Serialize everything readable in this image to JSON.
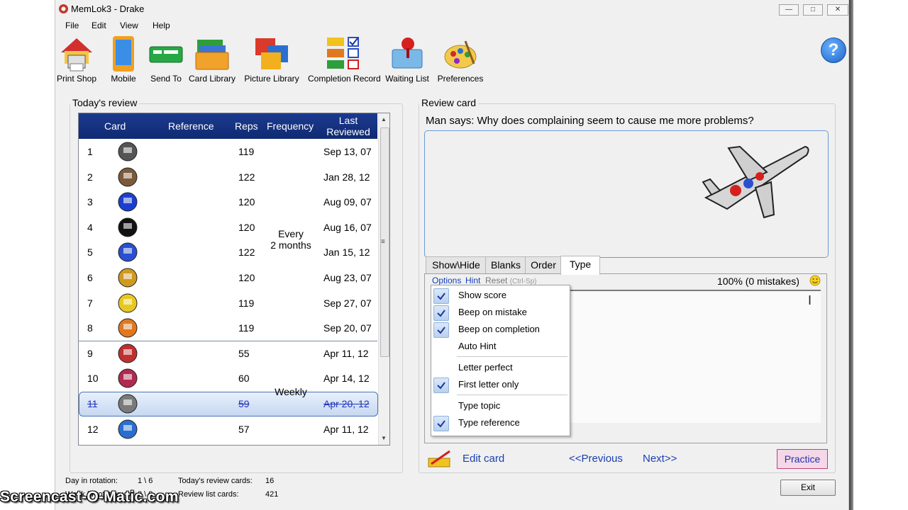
{
  "window": {
    "title": "MemLok3 - Drake"
  },
  "menu": [
    "File",
    "Edit",
    "View",
    "Help"
  ],
  "toolbar": [
    {
      "label": "Print Shop",
      "icon": "house-printer-icon"
    },
    {
      "label": "Mobile",
      "icon": "mobile-phone-icon"
    },
    {
      "label": "Send To",
      "icon": "card-send-icon"
    },
    {
      "label": "Card Library",
      "icon": "card-folder-icon"
    },
    {
      "label": "Picture Library",
      "icon": "picture-frames-icon"
    },
    {
      "label": "Completion Record",
      "icon": "checklist-icon"
    },
    {
      "label": "Waiting List",
      "icon": "push-pin-card-icon"
    },
    {
      "label": "Preferences",
      "icon": "paint-palette-icon"
    }
  ],
  "left": {
    "title": "Today's review",
    "columns": {
      "card": "Card",
      "reference": "Reference",
      "reps": "Reps",
      "frequency": "Frequency",
      "last_reviewed_1": "Last",
      "last_reviewed_2": "Reviewed"
    },
    "rows": [
      {
        "num": "1",
        "reps": "119",
        "date": "Sep 13, 07",
        "pic": "backpack-picture"
      },
      {
        "num": "2",
        "reps": "122",
        "date": "Jan 28, 12",
        "pic": "person-picture"
      },
      {
        "num": "3",
        "reps": "120",
        "date": "Aug 09, 07",
        "pic": "runner-picture"
      },
      {
        "num": "4",
        "reps": "120",
        "date": "Aug 16, 07",
        "pic": "bag-picture"
      },
      {
        "num": "5",
        "reps": "122",
        "date": "Jan 15, 12",
        "pic": "figure-picture"
      },
      {
        "num": "6",
        "reps": "120",
        "date": "Aug 23, 07",
        "pic": "gift-picture"
      },
      {
        "num": "7",
        "reps": "119",
        "date": "Sep 27, 07",
        "pic": "badge-picture"
      },
      {
        "num": "8",
        "reps": "119",
        "date": "Sep 20, 07",
        "pic": "food-picture"
      },
      {
        "num": "9",
        "reps": "55",
        "date": "Apr 11, 12",
        "pic": "sign-picture"
      },
      {
        "num": "10",
        "reps": "60",
        "date": "Apr 14, 12",
        "pic": "woman-picture"
      },
      {
        "num": "11",
        "reps": "59",
        "date": "Apr 20, 12",
        "pic": "airplane-picture"
      },
      {
        "num": "12",
        "reps": "57",
        "date": "Apr 11, 12",
        "pic": "man-picture"
      }
    ],
    "freq_group1_a": "Every",
    "freq_group1_b": "2 months",
    "freq_group2": "Weekly",
    "selected_index": 10
  },
  "right": {
    "title": "Review card",
    "question": "Man says:  Why does complaining seem to cause me more problems?",
    "tabs": [
      "Show\\Hide",
      "Blanks",
      "Order",
      "Type"
    ],
    "active_tab": 3,
    "options_link": "Options",
    "hint_link": "Hint",
    "reset_text": "Reset",
    "reset_shortcut": "(Ctrl-Sp)",
    "score": "100% (0 mistakes)",
    "dropdown": [
      {
        "label": "Show score",
        "checked": true
      },
      {
        "label": "Beep on mistake",
        "checked": true
      },
      {
        "label": "Beep on completion",
        "checked": true
      },
      {
        "label": "Auto Hint",
        "checked": false
      },
      {
        "label": "Letter perfect",
        "checked": false
      },
      {
        "label": "First letter only",
        "checked": true
      },
      {
        "label": "Type topic",
        "checked": false
      },
      {
        "label": "Type reference",
        "checked": true
      }
    ],
    "edit_card": "Edit card",
    "previous": "<<Previous",
    "next": "Next>>",
    "practice": "Practice"
  },
  "status": {
    "day_label": "Day in rotation:",
    "day_value": "1 \\ 6",
    "week_label": "Week in rotation:",
    "week_value": "2 \\ 8",
    "today_label": "Today's review cards:",
    "today_value": "16",
    "list_label": "Review list cards:",
    "list_value": "421",
    "exit": "Exit"
  },
  "watermark": "Screencast-O-Matic.com",
  "colors": {
    "header_blue": "#1c3a8f",
    "link_blue": "#1a3fb0",
    "practice_border": "#c0407c"
  }
}
